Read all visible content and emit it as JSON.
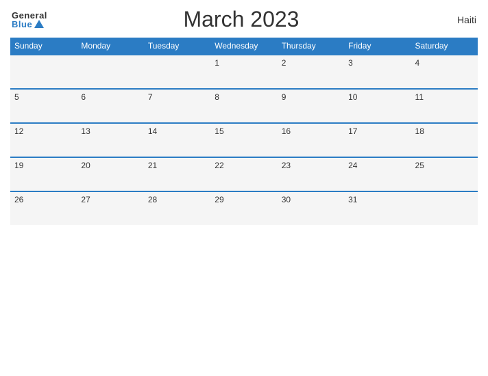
{
  "logo": {
    "general": "General",
    "blue": "Blue"
  },
  "title": "March 2023",
  "country": "Haiti",
  "weekdays": [
    "Sunday",
    "Monday",
    "Tuesday",
    "Wednesday",
    "Thursday",
    "Friday",
    "Saturday"
  ],
  "weeks": [
    [
      {
        "day": "",
        "empty": true
      },
      {
        "day": "",
        "empty": true
      },
      {
        "day": "",
        "empty": true
      },
      {
        "day": "1",
        "empty": false
      },
      {
        "day": "2",
        "empty": false
      },
      {
        "day": "3",
        "empty": false
      },
      {
        "day": "4",
        "empty": false
      }
    ],
    [
      {
        "day": "5",
        "empty": false
      },
      {
        "day": "6",
        "empty": false
      },
      {
        "day": "7",
        "empty": false
      },
      {
        "day": "8",
        "empty": false
      },
      {
        "day": "9",
        "empty": false
      },
      {
        "day": "10",
        "empty": false
      },
      {
        "day": "11",
        "empty": false
      }
    ],
    [
      {
        "day": "12",
        "empty": false
      },
      {
        "day": "13",
        "empty": false
      },
      {
        "day": "14",
        "empty": false
      },
      {
        "day": "15",
        "empty": false
      },
      {
        "day": "16",
        "empty": false
      },
      {
        "day": "17",
        "empty": false
      },
      {
        "day": "18",
        "empty": false
      }
    ],
    [
      {
        "day": "19",
        "empty": false
      },
      {
        "day": "20",
        "empty": false
      },
      {
        "day": "21",
        "empty": false
      },
      {
        "day": "22",
        "empty": false
      },
      {
        "day": "23",
        "empty": false
      },
      {
        "day": "24",
        "empty": false
      },
      {
        "day": "25",
        "empty": false
      }
    ],
    [
      {
        "day": "26",
        "empty": false
      },
      {
        "day": "27",
        "empty": false
      },
      {
        "day": "28",
        "empty": false
      },
      {
        "day": "29",
        "empty": false
      },
      {
        "day": "30",
        "empty": false
      },
      {
        "day": "31",
        "empty": false
      },
      {
        "day": "",
        "empty": true
      }
    ]
  ],
  "colors": {
    "header_bg": "#2b7cc4",
    "row_border": "#2b7cc4",
    "cell_bg": "#f5f5f5"
  }
}
